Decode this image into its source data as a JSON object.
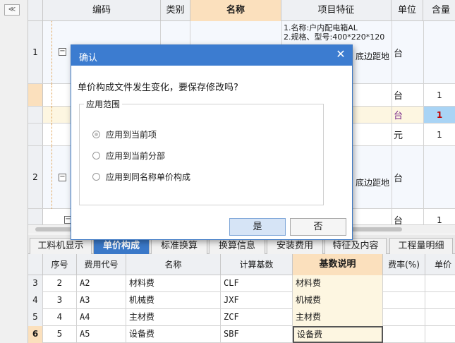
{
  "left_strip": {
    "collapse_glyph": "≪"
  },
  "top_grid": {
    "columns": [
      "编码",
      "类别",
      "名称",
      "项目特征",
      "单位",
      "含量"
    ],
    "rows": [
      {
        "num": "1",
        "unit": "台",
        "qty": "",
        "feature_lines": [
          "1.名称:户内配电箱AL",
          "2.规格、型号:400*220*120"
        ],
        "feature_tail": "底边距地"
      },
      {
        "num": "",
        "unit": "台",
        "qty": "1",
        "feature_lines": [],
        "feature_tail": ""
      },
      {
        "num": "",
        "unit": "台",
        "qty": "1",
        "feature_lines": [],
        "feature_tail": ""
      },
      {
        "num": "",
        "unit": "元",
        "qty": "1",
        "feature_lines": [],
        "feature_tail": ""
      },
      {
        "num": "2",
        "unit": "台",
        "qty": "",
        "feature_lines": [],
        "feature_tail": "底边距地"
      },
      {
        "num": "",
        "unit": "台",
        "qty": "1",
        "feature_lines": [],
        "feature_tail": ""
      }
    ],
    "tree_glyph": "−"
  },
  "tabs": [
    "工料机显示",
    "单价构成",
    "标准换算",
    "换算信息",
    "安装费用",
    "特征及内容",
    "工程量明细"
  ],
  "bottom_grid": {
    "columns": [
      "序号",
      "费用代号",
      "名称",
      "计算基数",
      "基数说明",
      "费率(%)",
      "单价"
    ],
    "rows": [
      {
        "rn": "3",
        "seq": "2",
        "code": "A2",
        "name": "材料费",
        "base": "CLF",
        "desc": "材料费"
      },
      {
        "rn": "4",
        "seq": "3",
        "code": "A3",
        "name": "机械费",
        "base": "JXF",
        "desc": "机械费"
      },
      {
        "rn": "5",
        "seq": "4",
        "code": "A4",
        "name": "主材费",
        "base": "ZCF",
        "desc": "主材费"
      },
      {
        "rn": "6",
        "seq": "5",
        "code": "A5",
        "name": "设备费",
        "base": "SBF",
        "desc": "设备费"
      }
    ]
  },
  "dialog": {
    "title": "确认",
    "close_glyph": "✕",
    "message": "单价构成文件发生变化，要保存修改吗?",
    "group_label": "应用范围",
    "options": [
      "应用到当前项",
      "应用到当前分部",
      "应用到同名称单价构成"
    ],
    "selected_option": "应用到当前项",
    "yes_label": "是",
    "no_label": "否"
  },
  "colors": {
    "accent": "#3c7cd0",
    "header_active": "#fbe0bd",
    "selected_cell": "#a9d4f5",
    "qty_highlight": "#c00000",
    "unit_purple": "#7a2a8a"
  }
}
